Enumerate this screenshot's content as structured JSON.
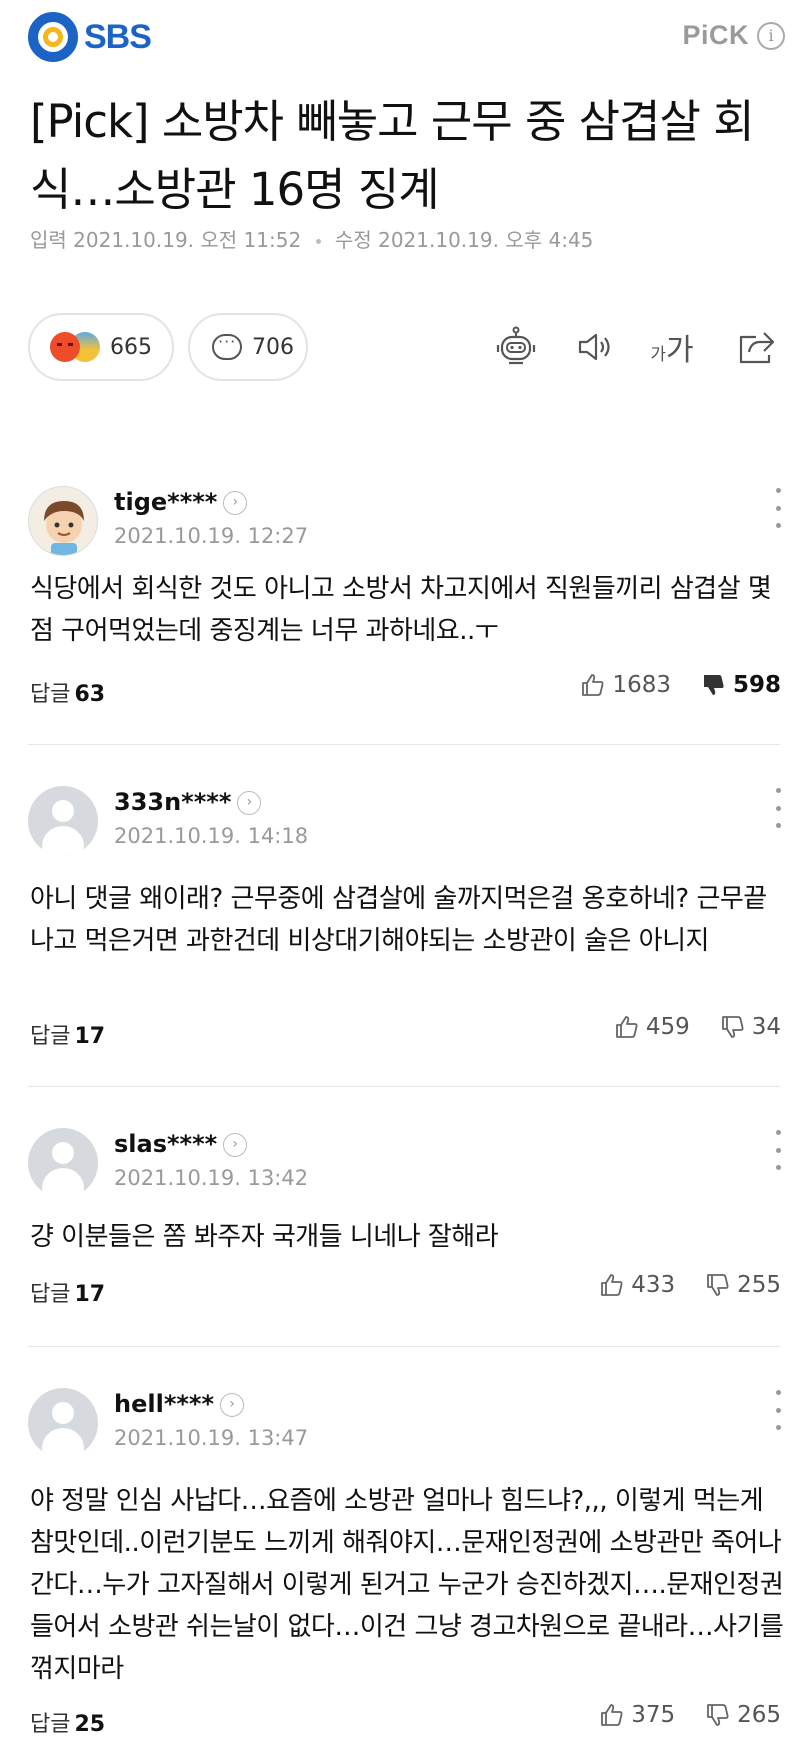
{
  "header": {
    "logo_text": "SBS",
    "pick_label": "PiCK",
    "info_glyph": "i"
  },
  "article": {
    "title": "[Pick] 소방차 빼놓고 근무 중 삼겹살 회식…소방관 16명 징계",
    "published_label": "입력",
    "published": "2021.10.19. 오전 11:52",
    "updated_label": "수정",
    "updated": "2021.10.19. 오후 4:45"
  },
  "actions": {
    "reaction_count": "665",
    "comment_count": "706",
    "font_small": "가",
    "font_large": "가",
    "icons": [
      "angry-emoji",
      "sad-emoji",
      "speech-bubble-icon",
      "robot-icon",
      "speaker-icon",
      "font-size-icon",
      "share-icon"
    ]
  },
  "comments": [
    {
      "user": "tige****",
      "date": "2021.10.19. 12:27",
      "text": "식당에서 회식한 것도 아니고 소방서 차고지에서 직원들끼리 삼겹살 몇 점 구어먹었는데 중징계는 너무 과하네요..ㅜ",
      "reply_label": "답글",
      "reply_count": "63",
      "likes": "1683",
      "dislikes": "598",
      "avatar": "character"
    },
    {
      "user": "333n****",
      "date": "2021.10.19. 14:18",
      "text": "아니 댓글 왜이래? 근무중에 삼겹살에 술까지먹은걸 옹호하네? 근무끝나고 먹은거면 과한건데 비상대기해야되는 소방관이 술은 아니지",
      "reply_label": "답글",
      "reply_count": "17",
      "likes": "459",
      "dislikes": "34",
      "avatar": "default"
    },
    {
      "user": "slas****",
      "date": "2021.10.19. 13:42",
      "text": "걍 이분들은 쫌 봐주자 국개들 니네나 잘해라",
      "reply_label": "답글",
      "reply_count": "17",
      "likes": "433",
      "dislikes": "255",
      "avatar": "default"
    },
    {
      "user": "hell****",
      "date": "2021.10.19. 13:47",
      "text": "야 정말 인심 사납다…요즘에 소방관 얼마나 힘드냐?,,, 이렇게 먹는게 참맛인데..이런기분도 느끼게 해줘야지…문재인정권에 소방관만 죽어나간다…누가 고자질해서 이렇게 된거고 누군가 승진하겠지….문재인정권들어서 소방관 쉬는날이 없다…이건 그냥 경고차원으로 끝내라…사기를 꺾지마라",
      "reply_label": "답글",
      "reply_count": "25",
      "likes": "375",
      "dislikes": "265",
      "avatar": "default"
    }
  ]
}
